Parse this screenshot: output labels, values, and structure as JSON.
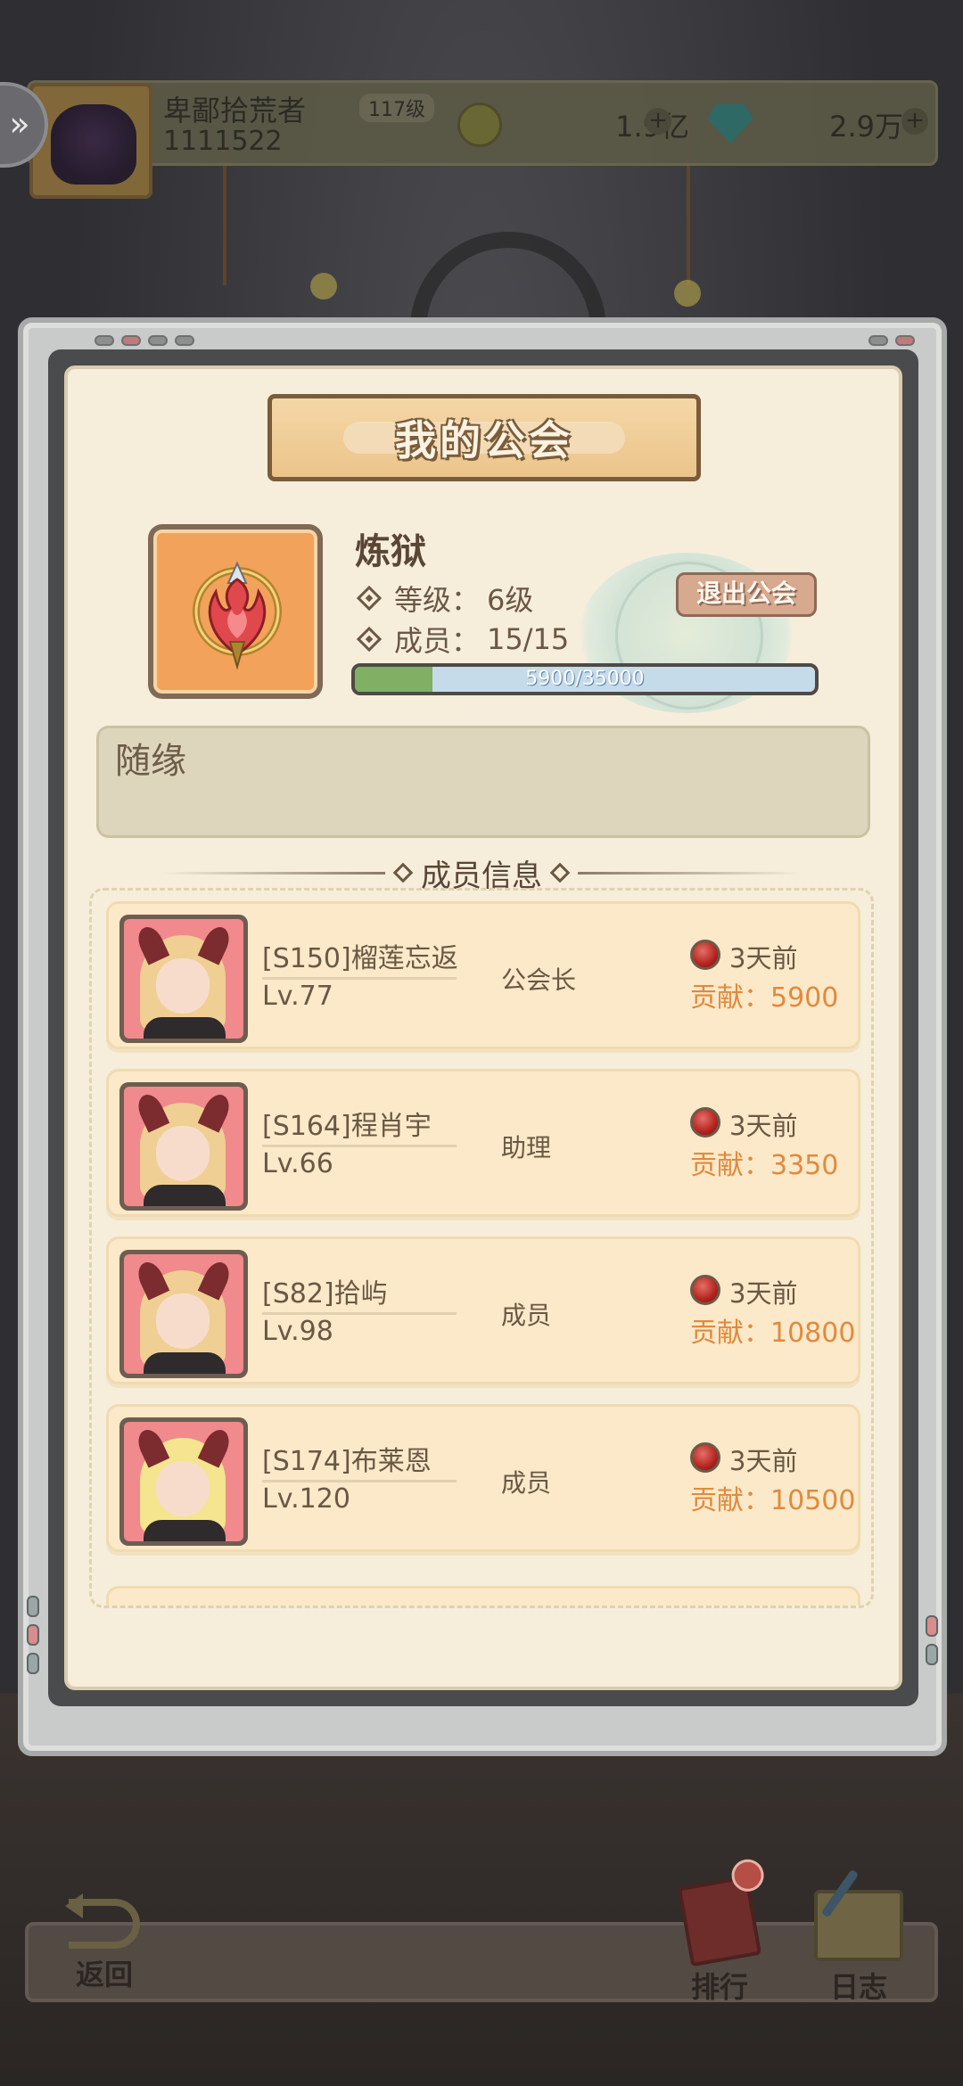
{
  "player": {
    "name": "卑鄙拾荒者",
    "level": "117级",
    "id": "1111522",
    "gold": "1.9亿",
    "gems": "2.9万"
  },
  "modal": {
    "title": "我的公会"
  },
  "guild": {
    "name": "炼狱",
    "level_label": "等级：",
    "level_value": "6级",
    "members_label": "成员：",
    "members_value": "15/15",
    "quit_button": "退出公会",
    "exp_current": 5900,
    "exp_max": 35000,
    "exp_text": "5900/35000",
    "notice": "随缘"
  },
  "members_section": {
    "title": "成员信息",
    "members": [
      {
        "name": "[S150]榴莲忘返",
        "level": "Lv.77",
        "role": "公会长",
        "last_online": "3天前",
        "contribution": "贡献：5900"
      },
      {
        "name": "[S164]程肖宇",
        "level": "Lv.66",
        "role": "助理",
        "last_online": "3天前",
        "contribution": "贡献：3350"
      },
      {
        "name": "[S82]拾屿",
        "level": "Lv.98",
        "role": "成员",
        "last_online": "3天前",
        "contribution": "贡献：10800"
      },
      {
        "name": "[S174]布莱恩",
        "level": "Lv.120",
        "role": "成员",
        "last_online": "3天前",
        "contribution": "贡献：10500"
      }
    ]
  },
  "bottom_nav": {
    "back": "返回",
    "rank": "排行",
    "log": "日志"
  },
  "colors": {
    "panel_bg": "#f6eedb",
    "card_bg": "#fbe9c9",
    "contribution": "#e08a3e",
    "progress_fill": "#7fb063",
    "progress_track": "#c5dbea"
  }
}
